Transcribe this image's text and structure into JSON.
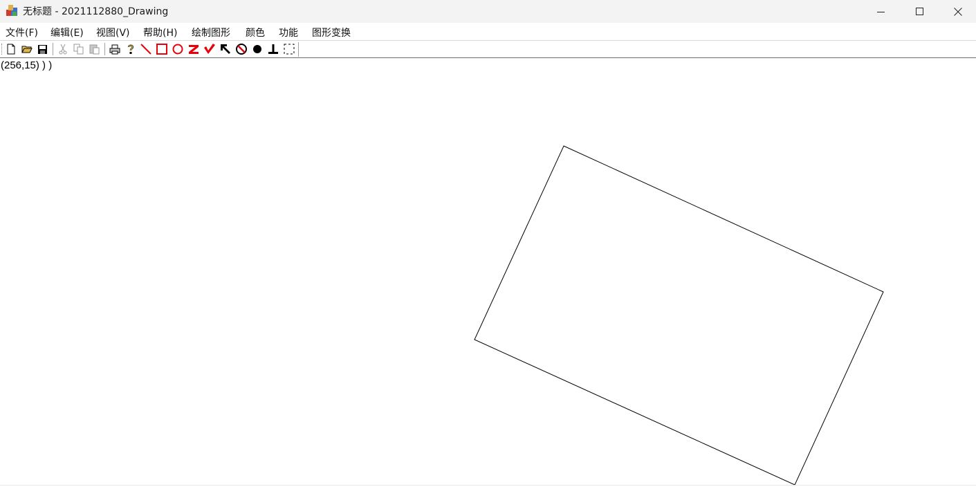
{
  "window": {
    "title": "无标题 - 2021112880_Drawing",
    "controls": {
      "minimize": "minimize-icon",
      "maximize": "maximize-icon",
      "close": "close-icon"
    }
  },
  "menu": {
    "items": [
      "文件(F)",
      "编辑(E)",
      "视图(V)",
      "帮助(H)",
      "绘制图形",
      "颜色",
      "功能",
      "图形变换"
    ]
  },
  "toolbar": {
    "buttons": [
      "new-file-icon",
      "open-folder-icon",
      "save-icon",
      "cut-icon",
      "copy-icon",
      "paste-icon",
      "print-icon",
      "help-icon",
      "draw-line-icon",
      "draw-rectangle-icon",
      "draw-circle-icon",
      "draw-z-icon",
      "draw-v-icon",
      "arrow-icon",
      "no-draw-icon",
      "filled-circle-icon",
      "perpendicular-icon",
      "selection-icon"
    ],
    "accent_color": "#e8000b"
  },
  "status": {
    "coordinate_text": "(256,15) ) )"
  },
  "canvas": {
    "background": "#ffffff",
    "shape": {
      "type": "rotated-rectangle",
      "stroke": "#000000"
    }
  }
}
